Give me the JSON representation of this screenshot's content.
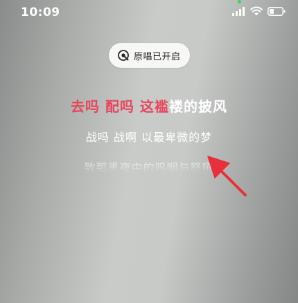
{
  "status_bar": {
    "time": "10:09"
  },
  "original_vocals_toggle": {
    "label": "原唱已开启",
    "icon": "microphone-icon"
  },
  "lyrics": {
    "current_sung": "去吗 配吗 这褴",
    "current_unsung": "褛的披风",
    "next": "战吗 战啊 以最卑微的梦",
    "upcoming": "致那黑夜中的呜咽与怒吼"
  },
  "colors": {
    "sung_lyric": "#e8455c",
    "arrow": "#e8303c",
    "signal_dot": "#3ad35a"
  }
}
